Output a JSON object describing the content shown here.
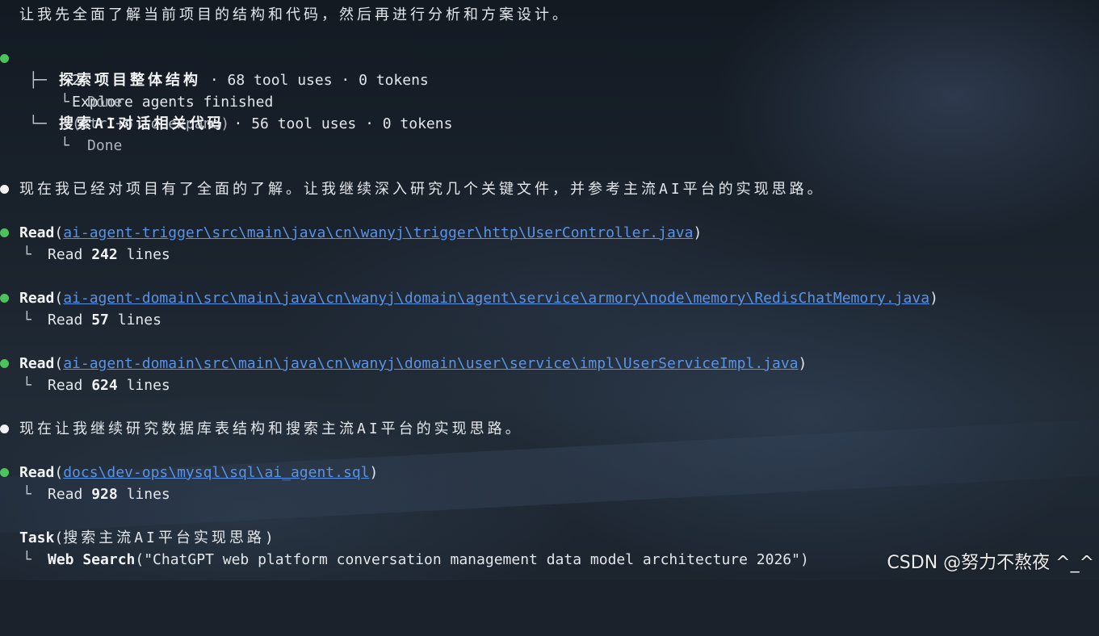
{
  "intro_line": "让我先全面了解当前项目的结构和代码，然后再进行分析和方案设计。",
  "explore": {
    "count": "2",
    "title": "Explore agents finished",
    "hint": "(ctrl+o to expand)",
    "agents": [
      {
        "tree": "├─",
        "name": "探索项目整体结构",
        "stats": " · 68 tool uses · 0 tokens",
        "status_prefix": "└",
        "status": "Done"
      },
      {
        "tree": "└─",
        "name": "搜索AI对话相关代码",
        "stats": " · 56 tool uses · 0 tokens",
        "status_prefix": "└",
        "status": "Done"
      }
    ]
  },
  "message_1": "现在我已经对项目有了全面的了解。让我继续深入研究几个关键文件，并参考主流AI平台的实现思路。",
  "reads": [
    {
      "tool": "Read",
      "path": "ai-agent-trigger\\src\\main\\java\\cn\\wanyj\\trigger\\http\\UserController.java",
      "result_prefix": "└",
      "result_word": "Read",
      "result_count": "242",
      "result_unit": "lines"
    },
    {
      "tool": "Read",
      "path": "ai-agent-domain\\src\\main\\java\\cn\\wanyj\\domain\\agent\\service\\armory\\node\\memory\\RedisChatMemory.java",
      "result_prefix": "└",
      "result_word": "Read",
      "result_count": "57",
      "result_unit": "lines"
    },
    {
      "tool": "Read",
      "path": "ai-agent-domain\\src\\main\\java\\cn\\wanyj\\domain\\user\\service\\impl\\UserServiceImpl.java",
      "result_prefix": "└",
      "result_word": "Read",
      "result_count": "624",
      "result_unit": "lines"
    }
  ],
  "message_2": "现在让我继续研究数据库表结构和搜索主流AI平台的实现思路。",
  "read_sql": {
    "tool": "Read",
    "path": "docs\\dev-ops\\mysql\\sql\\ai_agent.sql",
    "result_prefix": "└",
    "result_word": "Read",
    "result_count": "928",
    "result_unit": "lines"
  },
  "task": {
    "tool": "Task",
    "arg": "搜索主流AI平台实现思路",
    "sub_prefix": "└",
    "sub_tool": "Web Search",
    "sub_query": "(\"ChatGPT web platform conversation management data model architecture 2026\")"
  },
  "watermark": "CSDN @努力不熬夜 ^_^",
  "colors": {
    "bullet_green": "#4cc35b",
    "bullet_white": "#f2f2f2",
    "link": "#5a93e6",
    "text": "#e3e6ea"
  }
}
